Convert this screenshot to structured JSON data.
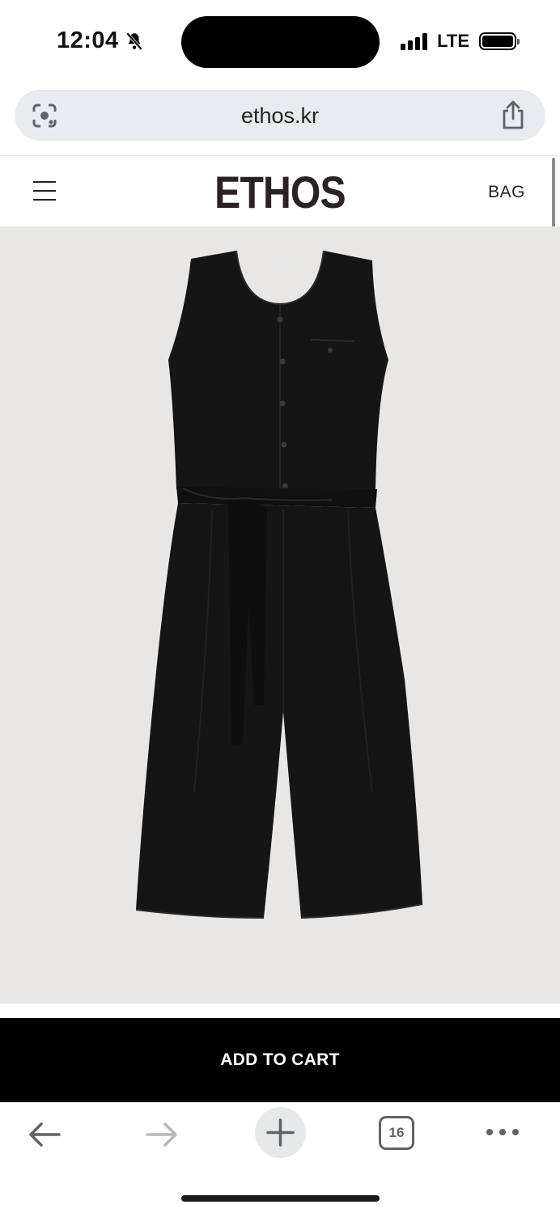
{
  "status_bar": {
    "time": "12:04",
    "network": "LTE",
    "icons": {
      "silent": "bell-slash-icon",
      "signal": "signal-bars-icon",
      "battery": "battery-icon"
    }
  },
  "browser": {
    "url": "ethos.kr",
    "icons": {
      "lens": "google-lens-icon",
      "share": "share-icon"
    }
  },
  "site_header": {
    "logo": "ETHOS",
    "bag_label": "BAG",
    "menu_icon": "hamburger-menu-icon"
  },
  "product": {
    "image_subject": "black-sleeveless-jumpsuit",
    "background_color": "#e8e7e5"
  },
  "cta": {
    "add_to_cart_label": "ADD TO CART"
  },
  "toolbar": {
    "tab_count": "16",
    "icons": {
      "back": "back-arrow-icon",
      "forward": "forward-arrow-icon",
      "new_tab": "plus-icon",
      "tabs": "tab-switcher-icon",
      "more": "more-dots-icon"
    }
  },
  "colors": {
    "brand": "#2b2323",
    "cta_background": "#000000",
    "cta_text": "#ffffff",
    "url_bar": "#e9ecef"
  }
}
